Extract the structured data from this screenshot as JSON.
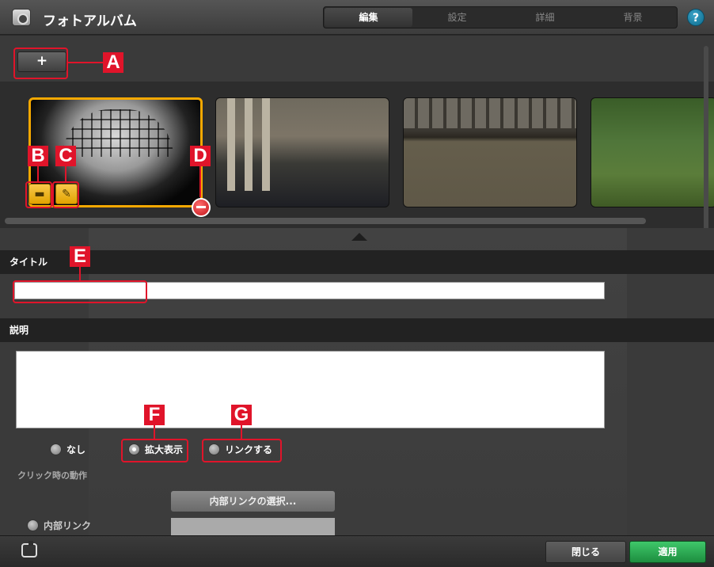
{
  "window": {
    "title": "フォトアルバム",
    "help_label": "?"
  },
  "tabs": [
    {
      "label": "編集",
      "active": true
    },
    {
      "label": "設定",
      "active": false
    },
    {
      "label": "詳細",
      "active": false
    },
    {
      "label": "背景",
      "active": false
    }
  ],
  "toolbar": {
    "add_label": "+"
  },
  "markers": {
    "a": "A",
    "b": "B",
    "c": "C",
    "d": "D",
    "e": "E",
    "f": "F",
    "g": "G"
  },
  "sections": {
    "title_label": "タイトル",
    "description_label": "説明"
  },
  "click_action": {
    "label": "クリック時の動作",
    "options": [
      {
        "label": "なし",
        "selected": false
      },
      {
        "label": "拡大表示",
        "selected": true
      },
      {
        "label": "リンクする",
        "selected": false
      }
    ],
    "internal_link_label": "内部リンク",
    "select_link_button": "内部リンクの選択..."
  },
  "footer": {
    "close_label": "閉じる",
    "apply_label": "適用"
  },
  "colors": {
    "accent_selection": "#f5a800",
    "marker": "#e0142a",
    "apply_green": "#2aa84f",
    "help_blue": "#1589b0"
  }
}
